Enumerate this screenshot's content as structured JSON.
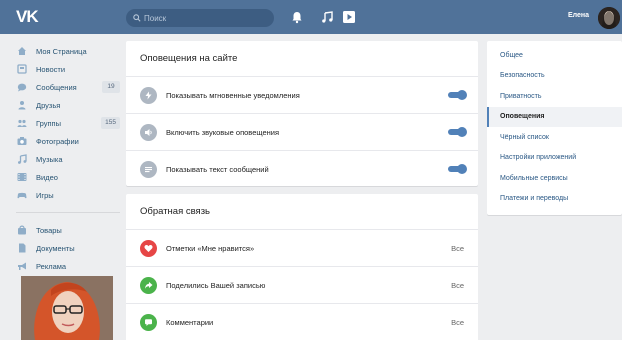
{
  "header": {
    "logo": "VK",
    "search_placeholder": "Поиск",
    "user_name": "Елена"
  },
  "leftnav": {
    "items": [
      {
        "label": "Моя Страница",
        "icon": "home-icon"
      },
      {
        "label": "Новости",
        "icon": "news-icon"
      },
      {
        "label": "Сообщения",
        "icon": "messages-icon",
        "count": "19"
      },
      {
        "label": "Друзья",
        "icon": "friends-icon"
      },
      {
        "label": "Группы",
        "icon": "groups-icon",
        "count": "155"
      },
      {
        "label": "Фотографии",
        "icon": "camera-icon"
      },
      {
        "label": "Музыка",
        "icon": "music-icon"
      },
      {
        "label": "Видео",
        "icon": "video-icon"
      },
      {
        "label": "Игры",
        "icon": "games-icon"
      }
    ],
    "items2": [
      {
        "label": "Товары",
        "icon": "goods-icon"
      },
      {
        "label": "Документы",
        "icon": "documents-icon"
      },
      {
        "label": "Реклама",
        "icon": "ads-icon"
      }
    ]
  },
  "site_notifications": {
    "title": "Оповещения на сайте",
    "rows": [
      {
        "label": "Показывать мгновенные уведомления",
        "icon": "lightning-icon",
        "enabled": true
      },
      {
        "label": "Включить звуковые оповещения",
        "icon": "sound-icon",
        "enabled": true
      },
      {
        "label": "Показывать текст сообщений",
        "icon": "text-icon",
        "enabled": true
      }
    ]
  },
  "feedback": {
    "title": "Обратная связь",
    "rows": [
      {
        "label": "Отметки «Мне нравится»",
        "icon": "heart-icon",
        "value": "Все",
        "color": "#e64646"
      },
      {
        "label": "Поделились Вашей записью",
        "icon": "share-icon",
        "value": "Все",
        "color": "#4bb34b"
      },
      {
        "label": "Комментарии",
        "icon": "comment-icon",
        "value": "Все",
        "color": "#4bb34b"
      }
    ]
  },
  "settings_menu": {
    "items": [
      "Общее",
      "Безопасность",
      "Приватность",
      "Оповещения",
      "Чёрный список",
      "Настройки приложений",
      "Мобильные сервисы",
      "Платежи и переводы"
    ],
    "active": "Оповещения"
  },
  "colors": {
    "header_bg": "#507299",
    "accent": "#5181b8",
    "page_bg": "#edeef0",
    "link": "#2a5885"
  }
}
